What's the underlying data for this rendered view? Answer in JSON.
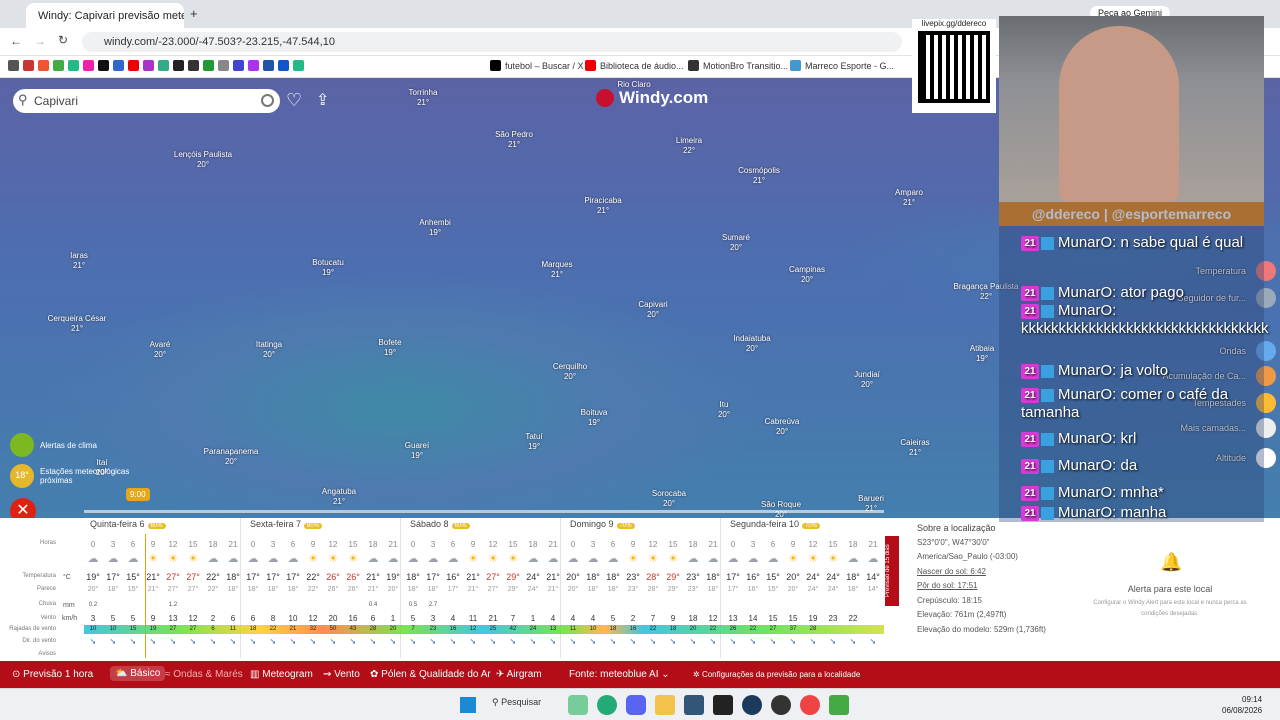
{
  "browser": {
    "tab_title": "Windy: Capivari previsão meteo",
    "url": "windy.com/-23.000/-47.503?-23.215,-47.544,10",
    "gemini": "Peça ao Gemini",
    "bookmarks": [
      "futebol – Buscar / X",
      "Biblioteca de áudio...",
      "MotionBro Transitio...",
      "Marreco Esporte - G..."
    ]
  },
  "map": {
    "search_value": "Capivari",
    "logo": "Windy.com",
    "time_marker": "9:00",
    "cities": [
      {
        "name": "Rio Claro",
        "t": ""
      },
      {
        "name": "Torrinha",
        "t": "21°"
      },
      {
        "name": "São Pedro",
        "t": "21°"
      },
      {
        "name": "Limeira",
        "t": "22°"
      },
      {
        "name": "Lençóis Paulista",
        "t": "20°"
      },
      {
        "name": "Cosmópolis",
        "t": "21°"
      },
      {
        "name": "Amparo",
        "t": "21°"
      },
      {
        "name": "Piracicaba",
        "t": "21°"
      },
      {
        "name": "Anhembi",
        "t": "19°"
      },
      {
        "name": "Sumaré",
        "t": "20°"
      },
      {
        "name": "Iaras",
        "t": "21°"
      },
      {
        "name": "Botucatu",
        "t": "19°"
      },
      {
        "name": "Marques",
        "t": "21°"
      },
      {
        "name": "Campinas",
        "t": "20°"
      },
      {
        "name": "Bragança Paulista",
        "t": "22°"
      },
      {
        "name": "Capivari",
        "t": "20°"
      },
      {
        "name": "Cerqueira César",
        "t": "21°"
      },
      {
        "name": "Avaré",
        "t": "20°"
      },
      {
        "name": "Itatinga",
        "t": "20°"
      },
      {
        "name": "Bofete",
        "t": "19°"
      },
      {
        "name": "Indaiatuba",
        "t": "20°"
      },
      {
        "name": "Atibaia",
        "t": "19°"
      },
      {
        "name": "Cerquilho",
        "t": "20°"
      },
      {
        "name": "Jundiaí",
        "t": "20°"
      },
      {
        "name": "Boituva",
        "t": "19°"
      },
      {
        "name": "Itu",
        "t": "20°"
      },
      {
        "name": "Cabreúva",
        "t": "20°"
      },
      {
        "name": "Tatuí",
        "t": "19°"
      },
      {
        "name": "Guareí",
        "t": "19°"
      },
      {
        "name": "Paranapanema",
        "t": "20°"
      },
      {
        "name": "Itaí",
        "t": "20°"
      },
      {
        "name": "Caieiras",
        "t": "21°"
      },
      {
        "name": "Angatuba",
        "t": "21°"
      },
      {
        "name": "Sorocaba",
        "t": "20°"
      },
      {
        "name": "São Roque",
        "t": "20°"
      },
      {
        "name": "Barueri",
        "t": "21°"
      }
    ],
    "left_panel": {
      "alerts": "Alertas de clima",
      "stations": "Estações meteorológicas próximas",
      "station_temp": "18°",
      "station_unit": "km/h"
    }
  },
  "forecast": {
    "days": [
      {
        "label": "Quinta-feira 6",
        "pct": "60%"
      },
      {
        "label": "Sexta-feira 7",
        "pct": "60%"
      },
      {
        "label": "Sábado 8",
        "pct": "60%"
      },
      {
        "label": "Domingo 9",
        "pct": "70%"
      },
      {
        "label": "Segunda-feira 10",
        "pct": "70%"
      }
    ],
    "row_labels": {
      "hours": "Horas",
      "temp": "Temperatura",
      "feels": "Parece",
      "rain": "Chuva",
      "wind": "Vento",
      "gusts": "Rajadas de vento",
      "dir": "Dir. do vento",
      "warn": "Avisos",
      "unit_c": "°C",
      "unit_mm": "mm",
      "unit_kmh": "km/h"
    },
    "hours": [
      "0",
      "3",
      "6",
      "9",
      "12",
      "15",
      "18",
      "21"
    ],
    "temps": [
      "19°",
      "17°",
      "15°",
      "21°",
      "27°",
      "27°",
      "22°",
      "18°",
      "17°",
      "17°",
      "17°",
      "22°",
      "26°",
      "26°",
      "21°",
      "19°",
      "18°",
      "17°",
      "16°",
      "21°",
      "27°",
      "29°",
      "24°",
      "21°",
      "20°",
      "18°",
      "18°",
      "23°",
      "28°",
      "29°",
      "23°",
      "18°",
      "17°",
      "16°",
      "15°",
      "20°",
      "24°",
      "24°",
      "18°",
      "14°"
    ],
    "feels": [
      "20°",
      "18°",
      "15°",
      "21°",
      "27°",
      "27°",
      "22°",
      "18°",
      "18°",
      "18°",
      "18°",
      "22°",
      "26°",
      "26°",
      "21°",
      "20°",
      "18°",
      "18°",
      "17°",
      "21°",
      "27°",
      "29°",
      "24°",
      "21°",
      "20°",
      "18°",
      "18°",
      "23°",
      "28°",
      "29°",
      "23°",
      "18°",
      "17°",
      "16°",
      "15°",
      "20°",
      "24°",
      "24°",
      "18°",
      "14°"
    ],
    "rain": [
      "0.2",
      "",
      "",
      "",
      "1.2",
      "",
      "",
      "",
      "",
      "",
      "",
      "",
      "",
      "",
      "0.4",
      "",
      "0.5",
      "2.7",
      "",
      "",
      "",
      "",
      "",
      "",
      "",
      "",
      "",
      "",
      "",
      "",
      "",
      "",
      "",
      "",
      "",
      "",
      "",
      "",
      "",
      ""
    ],
    "wind": [
      "3",
      "5",
      "5",
      "9",
      "13",
      "12",
      "2",
      "6",
      "6",
      "8",
      "10",
      "12",
      "20",
      "16",
      "6",
      "1",
      "5",
      "3",
      "4",
      "11",
      "21",
      "7",
      "1",
      "4",
      "4",
      "4",
      "5",
      "2",
      "7",
      "9",
      "18",
      "12",
      "13",
      "14",
      "15",
      "15",
      "19",
      "23",
      "22"
    ],
    "gusts": [
      "10",
      "10",
      "15",
      "19",
      "27",
      "27",
      "6",
      "11",
      "18",
      "22",
      "21",
      "32",
      "50",
      "43",
      "28",
      "20",
      "7",
      "23",
      "16",
      "12",
      "25",
      "42",
      "24",
      "13",
      "11",
      "10",
      "18",
      "16",
      "22",
      "18",
      "20",
      "22",
      "26",
      "22",
      "27",
      "37",
      "28"
    ],
    "sidebar": {
      "title": "Sobre a localização",
      "coords": "S23°0'0\", W47°30'0\"",
      "tz": "America/Sao_Paulo (-03:00)",
      "sunrise": "Nascer do sol: 6:42",
      "sunset": "Pôr do sol: 17:51",
      "dusk": "Crepúsculo: 18:15",
      "elev": "Elevação: 761m (2,497ft)",
      "model_elev": "Elevação do modelo: 529m (1,736ft)",
      "alert_title": "Alerta para este local",
      "alert_text": "Configurar o Windy Alert para este local e nunca perca as condições desejadas.",
      "side_tab": "Previsão de 15 dias"
    }
  },
  "bottombar": {
    "items": [
      "Previsão 1 hora",
      "Básico",
      "Ondas & Marés",
      "Meteogram",
      "Vento",
      "Pólen & Qualidade do Ar",
      "Airgram"
    ],
    "source": "Fonte: meteoblue AI",
    "settings": "Configurações da previsão para a localidade"
  },
  "taskbar": {
    "search": "Pesquisar",
    "time": "09:14",
    "date": "06/08/2026"
  },
  "overlay": {
    "qr_label": "livepix.gg/ddereco",
    "names": "@ddereco | @esportemarreco",
    "messages": [
      {
        "user": "MunarO:",
        "text": "n sabe qual é qual"
      },
      {
        "user": "MunarO:",
        "text": "ator pago"
      },
      {
        "user": "MunarO:",
        "text": "kkkkkkkkkkkkkkkkkkkkkkkkkkkkkkkkk"
      },
      {
        "user": "MunarO:",
        "text": "ja volto"
      },
      {
        "user": "MunarO:",
        "text": "comer o café da tamanha"
      },
      {
        "user": "MunarO:",
        "text": "krl"
      },
      {
        "user": "MunarO:",
        "text": "da"
      },
      {
        "user": "MunarO:",
        "text": "mnha*"
      },
      {
        "user": "MunarO:",
        "text": "manha"
      }
    ],
    "badge": "21",
    "right_menu": [
      "Temperatura",
      "Seguidor de fur...",
      "Ondas",
      "Acumulação de Ca...",
      "Tempestades",
      "Mais camadas...",
      "Altitude"
    ]
  }
}
